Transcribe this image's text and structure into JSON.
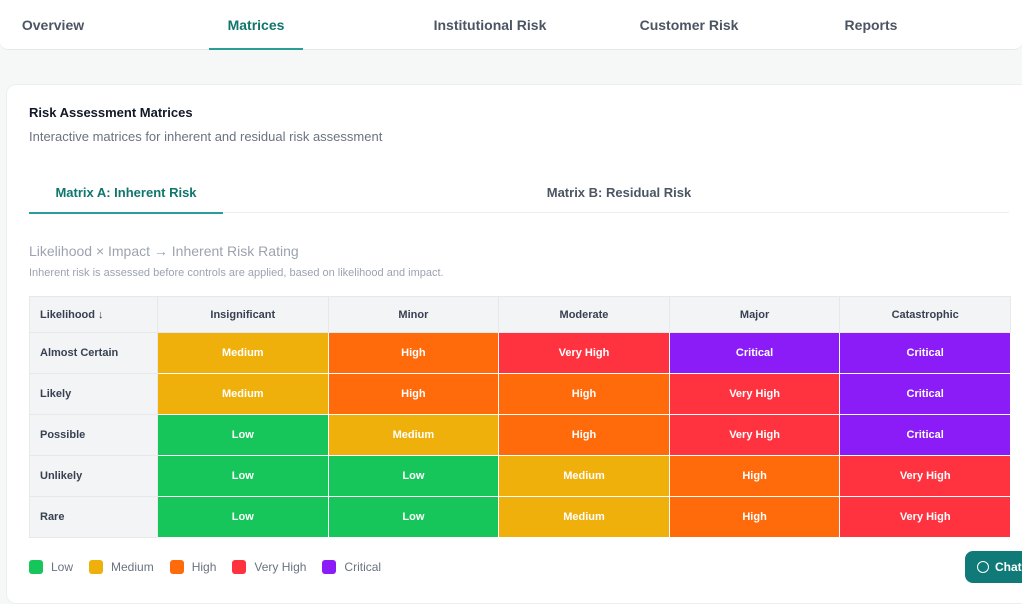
{
  "topnav": {
    "tabs": [
      {
        "label": "Overview"
      },
      {
        "label": "Matrices"
      },
      {
        "label": "Institutional Risk"
      },
      {
        "label": "Customer Risk"
      },
      {
        "label": "Reports"
      }
    ],
    "active_tab": "Matrices"
  },
  "card": {
    "title": "Risk Assessment Matrices",
    "subtitle": "Interactive matrices for inherent and residual risk assessment"
  },
  "matrix_tabs": {
    "tabs": [
      {
        "label": "Matrix A: Inherent Risk"
      },
      {
        "label": "Matrix B: Residual Risk"
      }
    ],
    "active_tab": "Matrix A: Inherent Risk"
  },
  "matrix": {
    "heading": "Likelihood × Impact → Inherent Risk Rating",
    "description": "Inherent risk is assessed before controls are applied, based on likelihood and impact.",
    "corner_label": "Likelihood ↓",
    "columns": [
      "Insignificant",
      "Minor",
      "Moderate",
      "Major",
      "Catastrophic"
    ],
    "rows": [
      {
        "label": "Almost Certain",
        "cells": [
          "Medium",
          "High",
          "Very High",
          "Critical",
          "Critical"
        ]
      },
      {
        "label": "Likely",
        "cells": [
          "Medium",
          "High",
          "High",
          "Very High",
          "Critical"
        ]
      },
      {
        "label": "Possible",
        "cells": [
          "Low",
          "Medium",
          "High",
          "Very High",
          "Critical"
        ]
      },
      {
        "label": "Unlikely",
        "cells": [
          "Low",
          "Low",
          "Medium",
          "High",
          "Very High"
        ]
      },
      {
        "label": "Rare",
        "cells": [
          "Low",
          "Low",
          "Medium",
          "High",
          "Very High"
        ]
      }
    ]
  },
  "colors": {
    "Low": "#16c65a",
    "Medium": "#efb00b",
    "High": "#ff6a0a",
    "Very High": "#ff3340",
    "Critical": "#8c1cf7",
    "accent": "#2a9d96"
  },
  "legend": [
    {
      "label": "Low"
    },
    {
      "label": "Medium"
    },
    {
      "label": "High"
    },
    {
      "label": "Very High"
    },
    {
      "label": "Critical"
    }
  ],
  "chat_button": {
    "label": "Chat",
    "icon": "chat-icon"
  }
}
